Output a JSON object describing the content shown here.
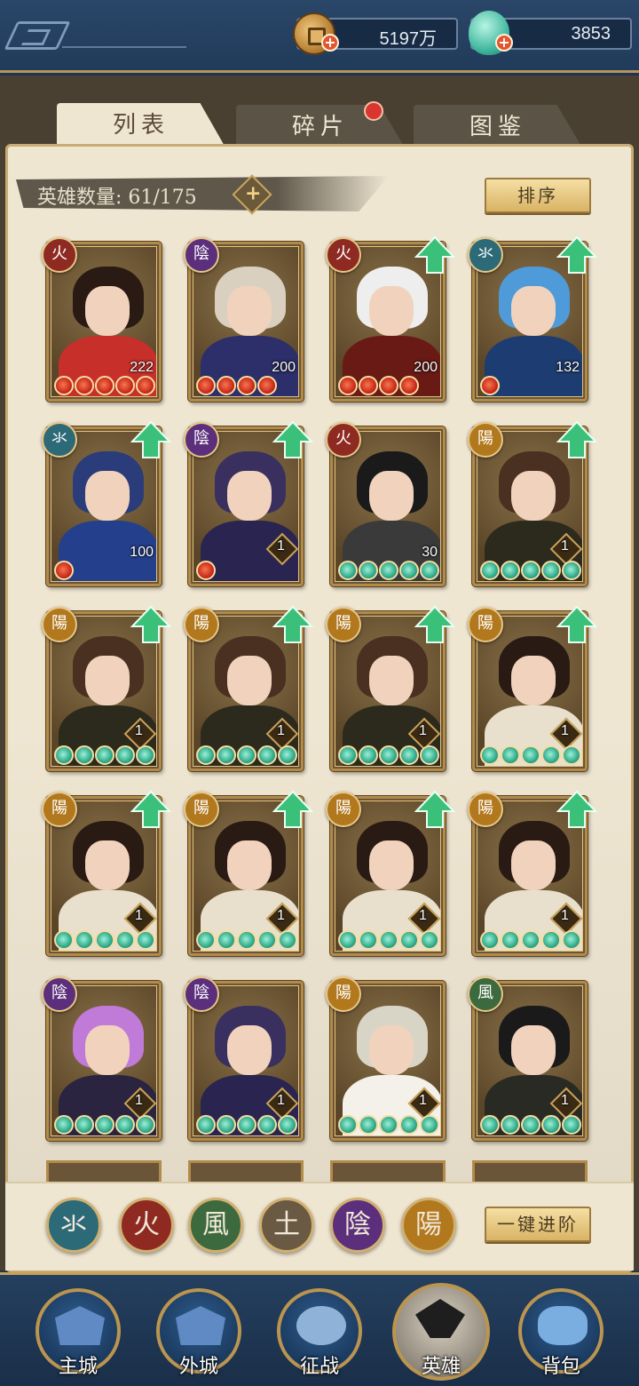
{
  "currency": {
    "coins": {
      "value": "5197万",
      "icon": "coin-icon"
    },
    "jade": {
      "value": "3853",
      "icon": "jade-pouch-icon"
    }
  },
  "tabs": [
    {
      "label": "列表",
      "active": true
    },
    {
      "label": "碎片",
      "active": false,
      "badge": true
    },
    {
      "label": "图鉴",
      "active": false
    }
  ],
  "hero_count": "英雄数量: 61/175",
  "sort_button": "排序",
  "elements": {
    "water": "氺",
    "fire": "火",
    "wind": "風",
    "earth": "土",
    "yin": "陰",
    "yang": "陽"
  },
  "heroes": [
    {
      "element": "火",
      "level": "222",
      "stars": 5,
      "star_type": "red",
      "upgrade": false,
      "colors": [
        "#2a1a14",
        "#c7302a"
      ]
    },
    {
      "element": "陰",
      "level": "200",
      "stars": 4,
      "star_type": "red",
      "upgrade": false,
      "colors": [
        "#d9d0c0",
        "#2c2f6a"
      ]
    },
    {
      "element": "火",
      "level": "200",
      "stars": 4,
      "star_type": "red",
      "upgrade": true,
      "colors": [
        "#eeeeee",
        "#6a1a14"
      ]
    },
    {
      "element": "氺",
      "level": "132",
      "stars": 1,
      "star_type": "red",
      "upgrade": true,
      "colors": [
        "#4f9ad8",
        "#1d3c72"
      ]
    },
    {
      "element": "氺",
      "level": "100",
      "stars": 1,
      "star_type": "red",
      "upgrade": true,
      "colors": [
        "#2a3c7a",
        "#243f8c"
      ]
    },
    {
      "element": "陰",
      "level": "1",
      "stars": 1,
      "star_type": "red",
      "upgrade": true,
      "colors": [
        "#3a3060",
        "#2a2450"
      ]
    },
    {
      "element": "火",
      "level": "30",
      "stars": 5,
      "star_type": "jade",
      "upgrade": false,
      "colors": [
        "#1a1a1a",
        "#3a3a3a"
      ]
    },
    {
      "element": "陽",
      "level": "1",
      "stars": 5,
      "star_type": "jade",
      "upgrade": true,
      "colors": [
        "#4a3020",
        "#2c2a1c"
      ]
    },
    {
      "element": "陽",
      "level": "1",
      "stars": 5,
      "star_type": "jade",
      "upgrade": true,
      "colors": [
        "#4a3020",
        "#2c2a1c"
      ]
    },
    {
      "element": "陽",
      "level": "1",
      "stars": 5,
      "star_type": "jade",
      "upgrade": true,
      "colors": [
        "#4a3020",
        "#2c2a1c"
      ]
    },
    {
      "element": "陽",
      "level": "1",
      "stars": 5,
      "star_type": "jade",
      "upgrade": true,
      "colors": [
        "#4a3020",
        "#2c2a1c"
      ]
    },
    {
      "element": "陽",
      "level": "1",
      "stars": 5,
      "star_type": "jade",
      "upgrade": true,
      "colors": [
        "#2a1a14",
        "#e8e0cc"
      ]
    },
    {
      "element": "陽",
      "level": "1",
      "stars": 5,
      "star_type": "jade",
      "upgrade": true,
      "colors": [
        "#2a1a14",
        "#e8e0cc"
      ]
    },
    {
      "element": "陽",
      "level": "1",
      "stars": 5,
      "star_type": "jade",
      "upgrade": true,
      "colors": [
        "#2a1a14",
        "#e8e0cc"
      ]
    },
    {
      "element": "陽",
      "level": "1",
      "stars": 5,
      "star_type": "jade",
      "upgrade": true,
      "colors": [
        "#2a1a14",
        "#e8e0cc"
      ]
    },
    {
      "element": "陽",
      "level": "1",
      "stars": 5,
      "star_type": "jade",
      "upgrade": true,
      "colors": [
        "#2a1a14",
        "#e8e0cc"
      ]
    },
    {
      "element": "陰",
      "level": "1",
      "stars": 5,
      "star_type": "jade",
      "upgrade": false,
      "colors": [
        "#c07ad8",
        "#2a2440"
      ]
    },
    {
      "element": "陰",
      "level": "1",
      "stars": 5,
      "star_type": "jade",
      "upgrade": false,
      "colors": [
        "#3a3060",
        "#2a2450"
      ]
    },
    {
      "element": "陽",
      "level": "1",
      "stars": 5,
      "star_type": "jade",
      "upgrade": false,
      "colors": [
        "#d8d4c6",
        "#f4f1ea"
      ]
    },
    {
      "element": "風",
      "level": "1",
      "stars": 5,
      "star_type": "jade",
      "upgrade": false,
      "colors": [
        "#1a1a1a",
        "#2a2a24"
      ]
    }
  ],
  "advance_button": "一键进阶",
  "nav": [
    {
      "label": "主城",
      "icon": "main-city-icon",
      "active": false
    },
    {
      "label": "外城",
      "icon": "outer-city-icon",
      "active": false
    },
    {
      "label": "征战",
      "icon": "battle-icon",
      "active": false
    },
    {
      "label": "英雄",
      "icon": "hero-icon",
      "active": true
    },
    {
      "label": "背包",
      "icon": "bag-icon",
      "active": false
    }
  ],
  "colors": {
    "water": "#2c6a78",
    "fire": "#8e2a22",
    "wind": "#3c6a3e",
    "earth": "#6a5a44",
    "yin": "#5c2f7c",
    "yang": "#b2781e",
    "upgrade_arrow": "#3bc07a"
  }
}
